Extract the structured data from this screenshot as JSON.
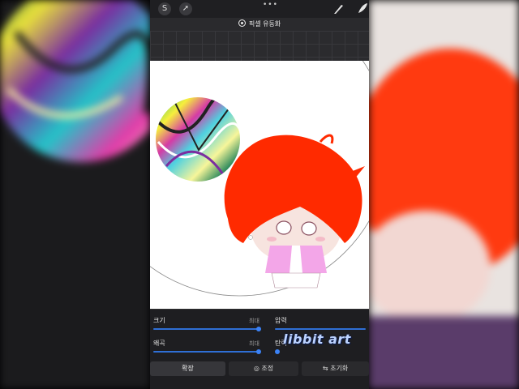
{
  "toolbar": {
    "left_icons": [
      "s-curve-icon",
      "arrow-icon"
    ],
    "more_icon": "•••",
    "right_icons": [
      "brush-icon",
      "smudge-icon"
    ]
  },
  "mode": {
    "label": "픽셀 유동화"
  },
  "controls": {
    "size_label": "크기",
    "size_max": "최대",
    "size_level": 1.0,
    "distortion_label": "왜곡",
    "distortion_max": "최대",
    "distortion_level": 1.0,
    "pressure_label": "압력",
    "momentum_label": "탄력"
  },
  "tabs": {
    "expand": "확장",
    "adjust": "조정",
    "reset": "초기화"
  },
  "watermark": {
    "text": "libbit art"
  },
  "colors": {
    "accent": "#3b82f6",
    "hair": "#ff2a00",
    "jacket": "#f3a6e8",
    "panel": "#1e1e21"
  }
}
